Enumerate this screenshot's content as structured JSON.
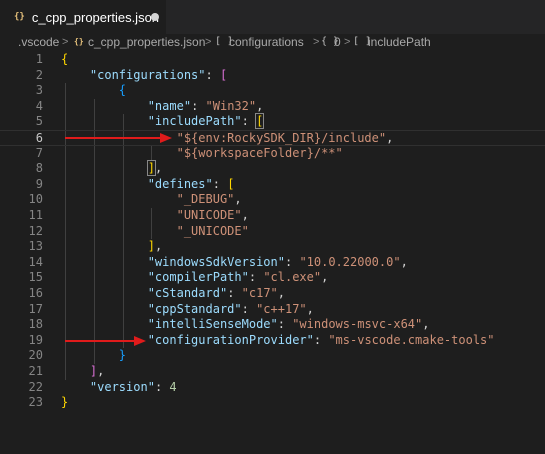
{
  "tab": {
    "icon": "{}",
    "icon_name": "json-file-icon",
    "label": "c_cpp_properties.json",
    "dirty": true
  },
  "breadcrumb": [
    {
      "kind": "text",
      "text": ".vscode"
    },
    {
      "kind": "sep",
      "text": ">"
    },
    {
      "kind": "icon",
      "text": "{}"
    },
    {
      "kind": "text",
      "text": "c_cpp_properties.json"
    },
    {
      "kind": "sep",
      "text": ">"
    },
    {
      "kind": "icon",
      "text": "[ ]"
    },
    {
      "kind": "text",
      "text": "configurations"
    },
    {
      "kind": "sep",
      "text": ">"
    },
    {
      "kind": "icon",
      "text": "{ }"
    },
    {
      "kind": "text",
      "text": "0"
    },
    {
      "kind": "sep",
      "text": ">"
    },
    {
      "kind": "icon",
      "text": "[ ]"
    },
    {
      "kind": "text",
      "text": "includePath"
    }
  ],
  "editor": {
    "current_line": 6,
    "lines": [
      {
        "n": "1",
        "tokens": [
          [
            "t-brace",
            "{"
          ]
        ]
      },
      {
        "n": "2",
        "tokens": [
          [
            "",
            "    "
          ],
          [
            "t-key",
            "\"configurations\""
          ],
          [
            "t-punc",
            ": "
          ],
          [
            "t-bracket",
            "["
          ]
        ]
      },
      {
        "n": "3",
        "tokens": [
          [
            "",
            "        "
          ],
          [
            "t-brace2",
            "{"
          ]
        ]
      },
      {
        "n": "4",
        "tokens": [
          [
            "",
            "            "
          ],
          [
            "t-key",
            "\"name\""
          ],
          [
            "t-punc",
            ": "
          ],
          [
            "t-str",
            "\"Win32\""
          ],
          [
            "t-punc",
            ","
          ]
        ]
      },
      {
        "n": "5",
        "tokens": [
          [
            "",
            "            "
          ],
          [
            "t-key",
            "\"includePath\""
          ],
          [
            "t-punc",
            ": "
          ],
          [
            "t-brace bracket-hl",
            "["
          ]
        ]
      },
      {
        "n": "6",
        "tokens": [
          [
            "",
            "                "
          ],
          [
            "t-str",
            "\"${env:RockySDK_DIR}/include\""
          ],
          [
            "t-punc",
            ","
          ]
        ]
      },
      {
        "n": "7",
        "tokens": [
          [
            "",
            "                "
          ],
          [
            "t-str",
            "\"${workspaceFolder}/**\""
          ]
        ]
      },
      {
        "n": "8",
        "tokens": [
          [
            "",
            "            "
          ],
          [
            "t-brace bracket-hl",
            "]"
          ],
          [
            "t-punc",
            ","
          ]
        ]
      },
      {
        "n": "9",
        "tokens": [
          [
            "",
            "            "
          ],
          [
            "t-key",
            "\"defines\""
          ],
          [
            "t-punc",
            ": "
          ],
          [
            "t-brace",
            "["
          ]
        ]
      },
      {
        "n": "10",
        "tokens": [
          [
            "",
            "                "
          ],
          [
            "t-str",
            "\"_DEBUG\""
          ],
          [
            "t-punc",
            ","
          ]
        ]
      },
      {
        "n": "11",
        "tokens": [
          [
            "",
            "                "
          ],
          [
            "t-str",
            "\"UNICODE\""
          ],
          [
            "t-punc",
            ","
          ]
        ]
      },
      {
        "n": "12",
        "tokens": [
          [
            "",
            "                "
          ],
          [
            "t-str",
            "\"_UNICODE\""
          ]
        ]
      },
      {
        "n": "13",
        "tokens": [
          [
            "",
            "            "
          ],
          [
            "t-brace",
            "]"
          ],
          [
            "t-punc",
            ","
          ]
        ]
      },
      {
        "n": "14",
        "tokens": [
          [
            "",
            "            "
          ],
          [
            "t-key",
            "\"windowsSdkVersion\""
          ],
          [
            "t-punc",
            ": "
          ],
          [
            "t-str",
            "\"10.0.22000.0\""
          ],
          [
            "t-punc",
            ","
          ]
        ]
      },
      {
        "n": "15",
        "tokens": [
          [
            "",
            "            "
          ],
          [
            "t-key",
            "\"compilerPath\""
          ],
          [
            "t-punc",
            ": "
          ],
          [
            "t-str",
            "\"cl.exe\""
          ],
          [
            "t-punc",
            ","
          ]
        ]
      },
      {
        "n": "16",
        "tokens": [
          [
            "",
            "            "
          ],
          [
            "t-key",
            "\"cStandard\""
          ],
          [
            "t-punc",
            ": "
          ],
          [
            "t-str",
            "\"c17\""
          ],
          [
            "t-punc",
            ","
          ]
        ]
      },
      {
        "n": "17",
        "tokens": [
          [
            "",
            "            "
          ],
          [
            "t-key",
            "\"cppStandard\""
          ],
          [
            "t-punc",
            ": "
          ],
          [
            "t-str",
            "\"c++17\""
          ],
          [
            "t-punc",
            ","
          ]
        ]
      },
      {
        "n": "18",
        "tokens": [
          [
            "",
            "            "
          ],
          [
            "t-key",
            "\"intelliSenseMode\""
          ],
          [
            "t-punc",
            ": "
          ],
          [
            "t-str",
            "\"windows-msvc-x64\""
          ],
          [
            "t-punc",
            ","
          ]
        ]
      },
      {
        "n": "19",
        "tokens": [
          [
            "",
            "            "
          ],
          [
            "t-key",
            "\"configurationProvider\""
          ],
          [
            "t-punc",
            ": "
          ],
          [
            "t-str",
            "\"ms-vscode.cmake-tools\""
          ]
        ]
      },
      {
        "n": "20",
        "tokens": [
          [
            "",
            "        "
          ],
          [
            "t-brace2",
            "}"
          ]
        ]
      },
      {
        "n": "21",
        "tokens": [
          [
            "",
            "    "
          ],
          [
            "t-bracket",
            "]"
          ],
          [
            "t-punc",
            ","
          ]
        ]
      },
      {
        "n": "22",
        "tokens": [
          [
            "",
            "    "
          ],
          [
            "t-key",
            "\"version\""
          ],
          [
            "t-punc",
            ": "
          ],
          [
            "t-num",
            "4"
          ]
        ]
      },
      {
        "n": "23",
        "tokens": [
          [
            "t-brace",
            "}"
          ]
        ]
      }
    ]
  },
  "annotations": {
    "arrow_color": "#e01b1b",
    "arrow_lines": [
      6,
      19
    ]
  }
}
